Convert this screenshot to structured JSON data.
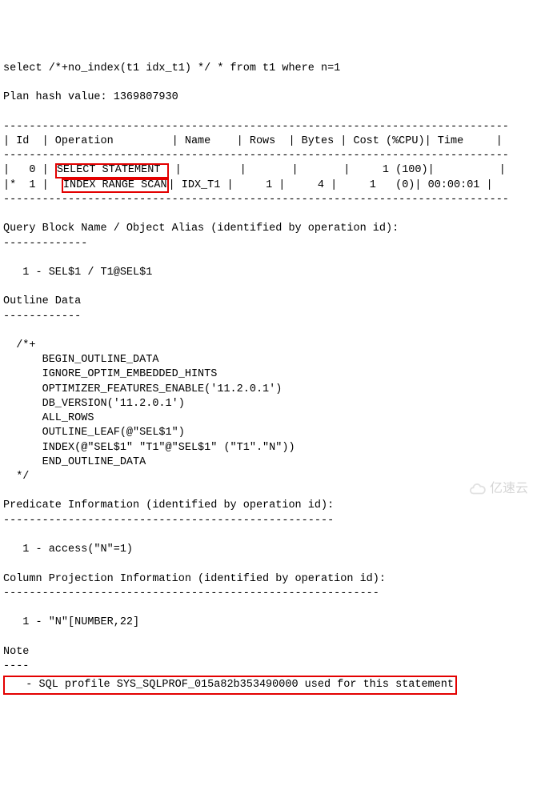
{
  "sql": "select /*+no_index(t1 idx_t1) */ * from t1 where n=1",
  "planHash": "Plan hash value: 1369807930",
  "sep_thin": "------------------------------------------------------------------------------",
  "sep_short_dash": "-------------",
  "sep_outline_dash": "------------",
  "sep_med_dash": "----",
  "sep_pred_dash": "---------------------------------------------------",
  "sep_colproj_dash": "----------------------------------------------------------",
  "plan": {
    "header": "| Id  | Operation         | Name    | Rows  | Bytes | Cost (%CPU)| Time     |",
    "row0_pre": "|   0 | ",
    "row0_op": "SELECT STATEMENT ",
    "row0_post": " |         |       |       |     1 (100)|          |",
    "row1_pre": "|*  1 |  ",
    "row1_op": "INDEX RANGE SCAN",
    "row1_post": "| IDX_T1 |     1 |     4 |     1   (0)| 00:00:01 |"
  },
  "qbn_header": "Query Block Name / Object Alias (identified by operation id):",
  "qbn_line": "   1 - SEL$1 / T1@SEL$1",
  "outline_header": "Outline Data",
  "outline": {
    "open": "  /*+",
    "l1": "      BEGIN_OUTLINE_DATA",
    "l2": "      IGNORE_OPTIM_EMBEDDED_HINTS",
    "l3": "      OPTIMIZER_FEATURES_ENABLE('11.2.0.1')",
    "l4": "      DB_VERSION('11.2.0.1')",
    "l5": "      ALL_ROWS",
    "l6": "      OUTLINE_LEAF(@\"SEL$1\")",
    "l7": "      INDEX(@\"SEL$1\" \"T1\"@\"SEL$1\" (\"T1\".\"N\"))",
    "l8": "      END_OUTLINE_DATA",
    "close": "  */"
  },
  "pred_header": "Predicate Information (identified by operation id):",
  "pred_line": "   1 - access(\"N\"=1)",
  "colproj_header": "Column Projection Information (identified by operation id):",
  "colproj_line": "   1 - \"N\"[NUMBER,22]",
  "note_header": "Note",
  "note_line": "   - SQL profile SYS_SQLPROF_015a82b353490000 used for this statement",
  "watermark": "亿速云"
}
